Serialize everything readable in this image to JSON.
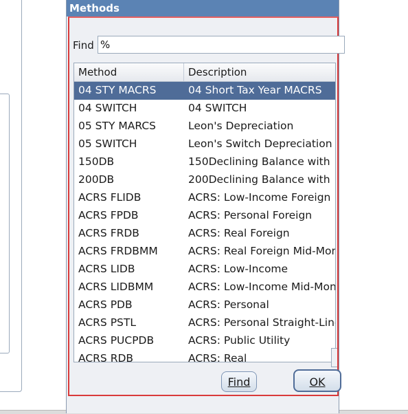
{
  "dialog": {
    "title": "Methods",
    "find_label": "Find",
    "find_value": "%",
    "columns": [
      "Method",
      "Description"
    ],
    "rows": [
      {
        "method": "04 STY MACRS",
        "description": "04 Short Tax Year MACRS",
        "selected": true
      },
      {
        "method": "04 SWITCH",
        "description": "04 SWITCH"
      },
      {
        "method": "05 STY MARCS",
        "description": "Leon's Depreciation"
      },
      {
        "method": "05 SWITCH",
        "description": "Leon's Switch Depreciation"
      },
      {
        "method": "150DB",
        "description": "150Declining Balance with"
      },
      {
        "method": "200DB",
        "description": "200Declining Balance with"
      },
      {
        "method": "ACRS FLIDB",
        "description": "ACRS: Low-Income Foreign"
      },
      {
        "method": "ACRS FPDB",
        "description": "ACRS: Personal Foreign"
      },
      {
        "method": "ACRS FRDB",
        "description": "ACRS: Real Foreign"
      },
      {
        "method": "ACRS FRDBMM",
        "description": "ACRS: Real Foreign Mid-Month"
      },
      {
        "method": "ACRS LIDB",
        "description": "ACRS: Low-Income"
      },
      {
        "method": "ACRS LIDBMM",
        "description": "ACRS: Low-Income Mid-Month"
      },
      {
        "method": "ACRS PDB",
        "description": "ACRS: Personal"
      },
      {
        "method": "ACRS PSTL",
        "description": "ACRS: Personal Straight-Line"
      },
      {
        "method": "ACRS PUCPDB",
        "description": "ACRS: Public Utility"
      },
      {
        "method": "ACRS RDB",
        "description": "ACRS: Real"
      }
    ],
    "buttons": {
      "find": "Find",
      "ok": "OK"
    }
  },
  "colors": {
    "title_bar": "#5b83b4",
    "selection": "#4f6c98",
    "focus_border": "#d93a3a"
  }
}
